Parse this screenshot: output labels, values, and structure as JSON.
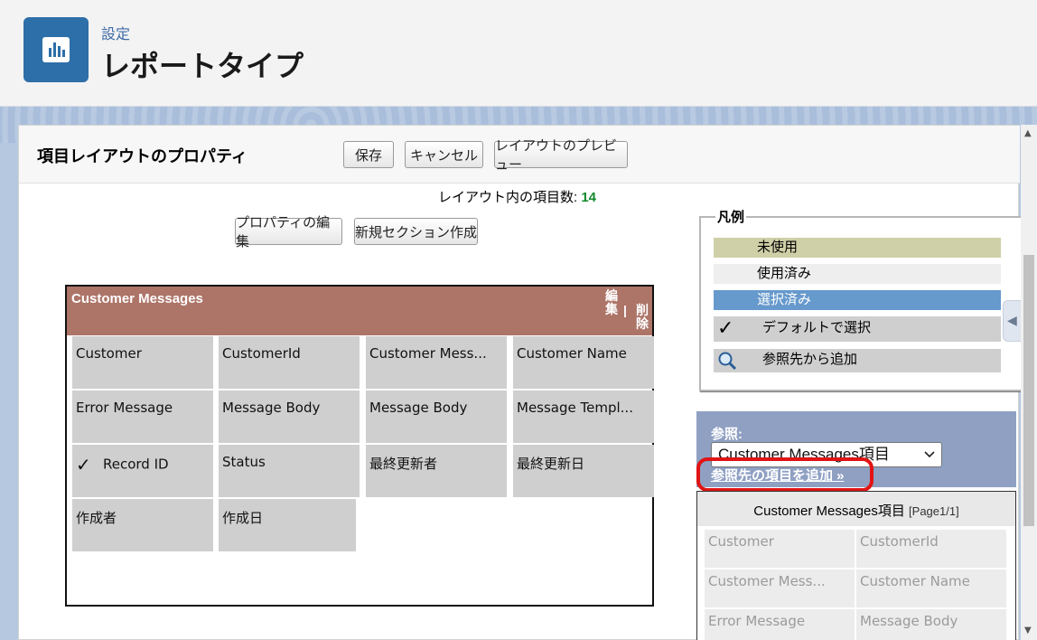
{
  "header": {
    "breadcrumb": "設定",
    "title": "レポートタイプ"
  },
  "panel": {
    "title": "項目レイアウトのプロパティ",
    "buttons": {
      "save": "保存",
      "cancel": "キャンセル",
      "preview": "レイアウトのプレビュー",
      "edit_properties": "プロパティの編集",
      "new_section": "新規セクション作成"
    },
    "field_count_label": "レイアウト内の項目数:",
    "field_count_value": "14"
  },
  "section": {
    "title": "Customer Messages",
    "edit_label": "編集",
    "separator": "|",
    "delete_label": "削除",
    "fields": [
      "Customer",
      "CustomerId",
      "Customer Mess...",
      "Customer Name",
      "Error Message",
      "Message Body",
      "Message Body",
      "Message Templ...",
      "Record ID",
      "Status",
      "最終更新者",
      "最終更新日",
      "作成者",
      "作成日"
    ]
  },
  "legend": {
    "title": "凡例",
    "items": [
      {
        "label": "未使用",
        "color": "#cfcfa8"
      },
      {
        "label": "使用済み",
        "color": "#eeeeee"
      },
      {
        "label": "選択済み",
        "color": "#6699cc"
      },
      {
        "label": "デフォルトで選択",
        "icon": "checkmark-icon"
      },
      {
        "label": "参照先から追加",
        "icon": "magnifier-icon"
      }
    ]
  },
  "lookup": {
    "label": "参照:",
    "selected": "Customer Messages項目",
    "add_link": "参照先の項目を追加 »"
  },
  "field_list": {
    "title": "Customer Messages項目",
    "page": "[Page1/1]",
    "items": [
      "Customer",
      "CustomerId",
      "Customer Mess...",
      "Customer Name",
      "Error Message",
      "Message Body"
    ]
  },
  "colors": {
    "section_header": "#ad7468",
    "header_icon": "#2d6fa8",
    "highlight": "#e11414",
    "count": "#118a2b"
  }
}
